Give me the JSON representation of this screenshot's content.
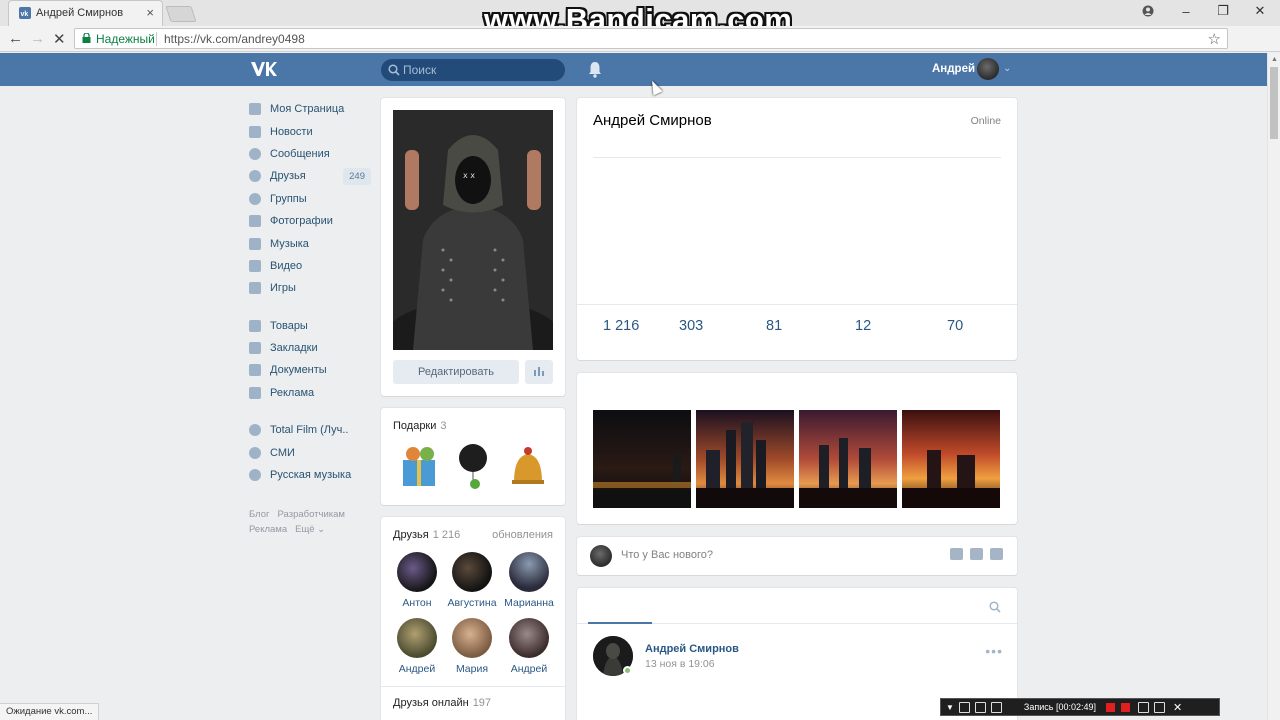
{
  "browser": {
    "tab_title": "Андрей Смирнов",
    "tab_close": "×",
    "secure_label": "Надежный",
    "url": "https://vk.com/andrey0498",
    "status_text": "Ожидание vk.com...",
    "watermark": "www.Bandicam.com",
    "recording_label": "Запись [00:02:49]"
  },
  "header": {
    "search_placeholder": "Поиск",
    "user_name": "Андрей"
  },
  "left_menu": {
    "items": [
      {
        "label": "Моя Страница",
        "icon": "home-icon"
      },
      {
        "label": "Новости",
        "icon": "news-icon"
      },
      {
        "label": "Сообщения",
        "icon": "messages-icon"
      },
      {
        "label": "Друзья",
        "icon": "friends-icon",
        "badge": "249"
      },
      {
        "label": "Группы",
        "icon": "groups-icon"
      },
      {
        "label": "Фотографии",
        "icon": "photos-icon"
      },
      {
        "label": "Музыка",
        "icon": "music-icon"
      },
      {
        "label": "Видео",
        "icon": "video-icon"
      },
      {
        "label": "Игры",
        "icon": "games-icon"
      }
    ],
    "items2": [
      {
        "label": "Товары",
        "icon": "goods-icon"
      },
      {
        "label": "Закладки",
        "icon": "bookmarks-icon"
      },
      {
        "label": "Документы",
        "icon": "documents-icon"
      },
      {
        "label": "Реклама",
        "icon": "ads-icon"
      }
    ],
    "items3": [
      {
        "label": "Total Film (Луч..",
        "icon": "community-icon"
      },
      {
        "label": "СМИ",
        "icon": "community-icon"
      },
      {
        "label": "Русская музыка",
        "icon": "community-icon"
      }
    ],
    "footer": [
      "Блог",
      "Разработчикам",
      "Реклама",
      "Ещё ⌄"
    ]
  },
  "profile": {
    "name": "Андрей Смирнов",
    "status": "Online",
    "edit_button": "Редактировать",
    "counters": [
      "1 216",
      "303",
      "81",
      "12",
      "70"
    ]
  },
  "gifts": {
    "title": "Подарки",
    "count": "3"
  },
  "friends": {
    "title": "Друзья",
    "count": "1 216",
    "updates_link": "обновления",
    "list": [
      "Антон",
      "Августина",
      "Марианна",
      "Андрей",
      "Мария",
      "Андрей"
    ],
    "online_title": "Друзья онлайн",
    "online_count": "197"
  },
  "post_box": {
    "placeholder": "Что у Вас нового?"
  },
  "wall_post": {
    "author": "Андрей Смирнов",
    "date": "13 ноя в 19:06"
  }
}
